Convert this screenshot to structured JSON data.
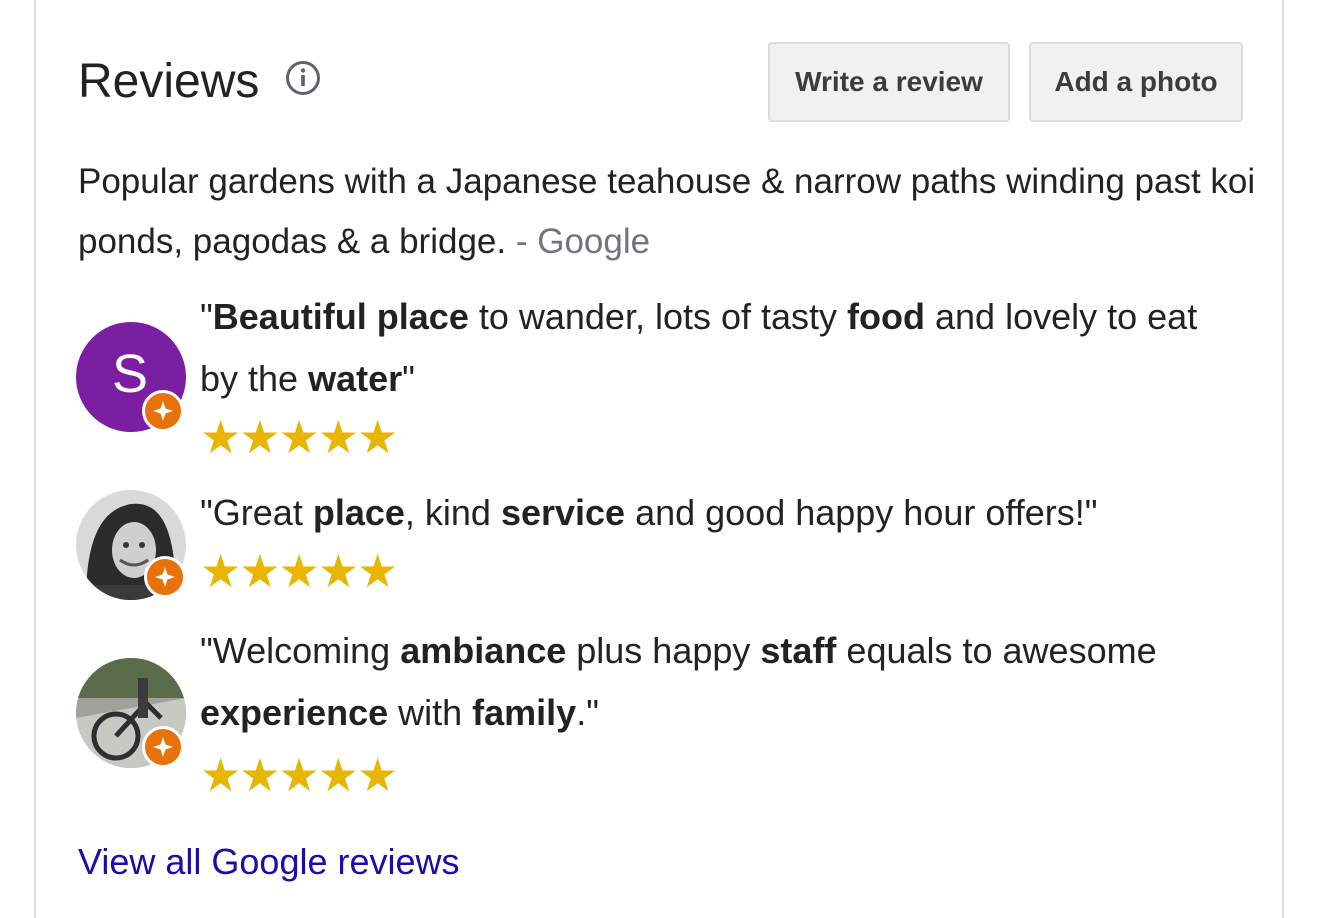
{
  "header": {
    "title": "Reviews",
    "write_review_label": "Write a review",
    "add_photo_label": "Add a photo"
  },
  "summary": {
    "text": "Popular gardens with a Japanese teahouse & narrow paths winding past koi ponds, pagodas & a bridge.",
    "source": "- Google"
  },
  "reviews": [
    {
      "avatar_initial": "S",
      "avatar_color": "#7b1fa2",
      "rating_stars": 5,
      "stars": "★★★★★",
      "segments": [
        {
          "t": "\"",
          "b": false
        },
        {
          "t": "Beautiful place",
          "b": true
        },
        {
          "t": " to wander, lots of tasty ",
          "b": false
        },
        {
          "t": "food",
          "b": true
        },
        {
          "t": " and lovely to eat by the ",
          "b": false
        },
        {
          "t": "water",
          "b": true
        },
        {
          "t": "\"",
          "b": false
        }
      ]
    },
    {
      "avatar_initial": "",
      "avatar_color": "#808080",
      "rating_stars": 5,
      "stars": "★★★★★",
      "segments": [
        {
          "t": "\"Great ",
          "b": false
        },
        {
          "t": "place",
          "b": true
        },
        {
          "t": ", kind ",
          "b": false
        },
        {
          "t": "service",
          "b": true
        },
        {
          "t": " and good happy hour offers!\"",
          "b": false
        }
      ]
    },
    {
      "avatar_initial": "",
      "avatar_color": "#6b6b5a",
      "rating_stars": 5,
      "stars": "★★★★★",
      "segments": [
        {
          "t": "\"Welcoming ",
          "b": false
        },
        {
          "t": "ambiance",
          "b": true
        },
        {
          "t": " plus happy ",
          "b": false
        },
        {
          "t": "staff",
          "b": true
        },
        {
          "t": " equals to awesome ",
          "b": false
        },
        {
          "t": "experience",
          "b": true
        },
        {
          "t": " with ",
          "b": false
        },
        {
          "t": "family",
          "b": true
        },
        {
          "t": ".\"",
          "b": false
        }
      ]
    }
  ],
  "footer": {
    "view_all_label": "View all Google reviews"
  },
  "colors": {
    "star": "#e8b600",
    "link": "#1a0dab",
    "badge": "#e8710a",
    "source_gray": "#70757a"
  },
  "icons": [
    "info-icon",
    "local-guide-badge-icon",
    "star-icon"
  ]
}
